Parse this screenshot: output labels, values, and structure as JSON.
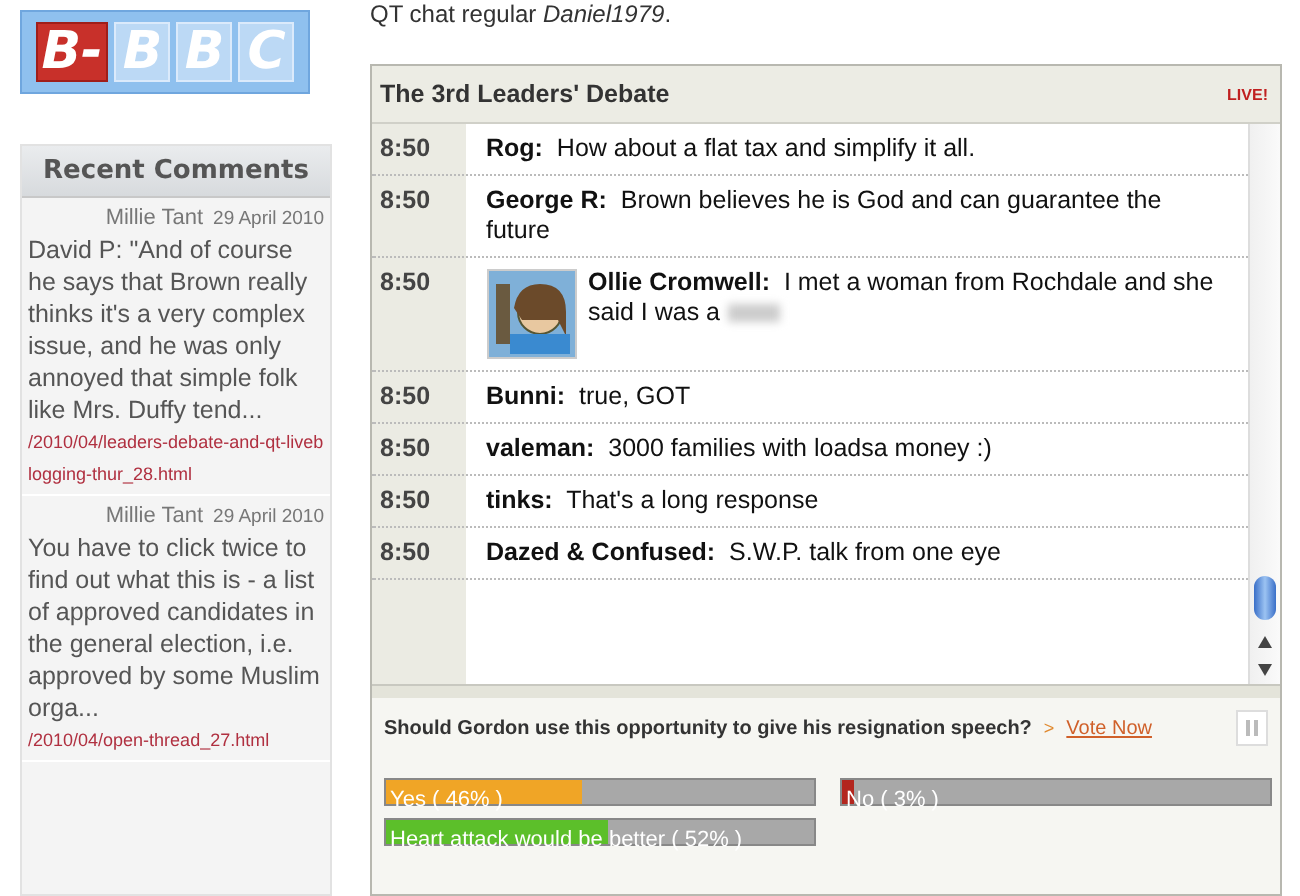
{
  "logo": {
    "tiles": [
      {
        "text": "B-",
        "kind": "accent"
      },
      {
        "text": "B",
        "kind": "plain"
      },
      {
        "text": "B",
        "kind": "plain"
      },
      {
        "text": "C",
        "kind": "plain"
      }
    ]
  },
  "sidebar": {
    "title": "Recent Comments",
    "comments": [
      {
        "text": "David P: \"And of course he says that Brown really thinks it's a very complex issue, and he was only annoyed that simple folk like Mrs. Duffy tend...",
        "author": "Millie Tant",
        "date": "29 April 2010",
        "link": "/2010/04/leaders-debate-and-qt-liveblogging-thur_28.html"
      },
      {
        "text": "You have to click twice to find out what this is  - a list of approved candidates in the general election, i.e. approved by some Muslim orga...",
        "author": "Millie Tant",
        "date": "29 April 2010",
        "link": "/2010/04/open-thread_27.html"
      }
    ]
  },
  "intro": "QT chat regular *Daniel1979*.",
  "widget": {
    "title": "The 3rd Leaders' Debate",
    "badge": "LIVE!",
    "messages": [
      {
        "time": "8:50",
        "author": "Rog:",
        "text": "How about a flat tax and simplify it all.",
        "kind": "plain",
        "censored": false
      },
      {
        "time": "8:50",
        "author": "George R:",
        "text": "Brown believes he is God and can guarantee the future",
        "kind": "plain",
        "censored": false
      },
      {
        "time": "8:50",
        "author": "Ollie Cromwell:",
        "text": "I met a woman from Rochdale and she said I was a",
        "kind": "avatar",
        "censored": true
      },
      {
        "time": "8:50",
        "author": "Bunni:",
        "text": "true, GOT",
        "kind": "plain",
        "censored": false
      },
      {
        "time": "8:50",
        "author": "valeman:",
        "text": "3000 families with loadsa money :)",
        "kind": "plain",
        "censored": false
      },
      {
        "time": "8:50",
        "author": "tinks:",
        "text": "That's a long response",
        "kind": "plain",
        "censored": false
      },
      {
        "time": "8:50",
        "author": "Dazed & Confused:",
        "text": "S.W.P. talk from one eye",
        "kind": "plain",
        "censored": false
      }
    ],
    "poll": {
      "question": "Should Gordon use this opportunity to give his resignation speech?",
      "marker": ">",
      "vote_link": "Vote Now",
      "options": [
        {
          "label": "Yes ( 46% )",
          "level": 0.46,
          "color": "#f0a526"
        },
        {
          "label": "No ( 3% )",
          "level": 0.03,
          "color": "#b3261e"
        },
        {
          "label": "Heart attack would be better ( 52% )",
          "level": 0.52,
          "color": "#5cbf2a"
        }
      ]
    }
  }
}
